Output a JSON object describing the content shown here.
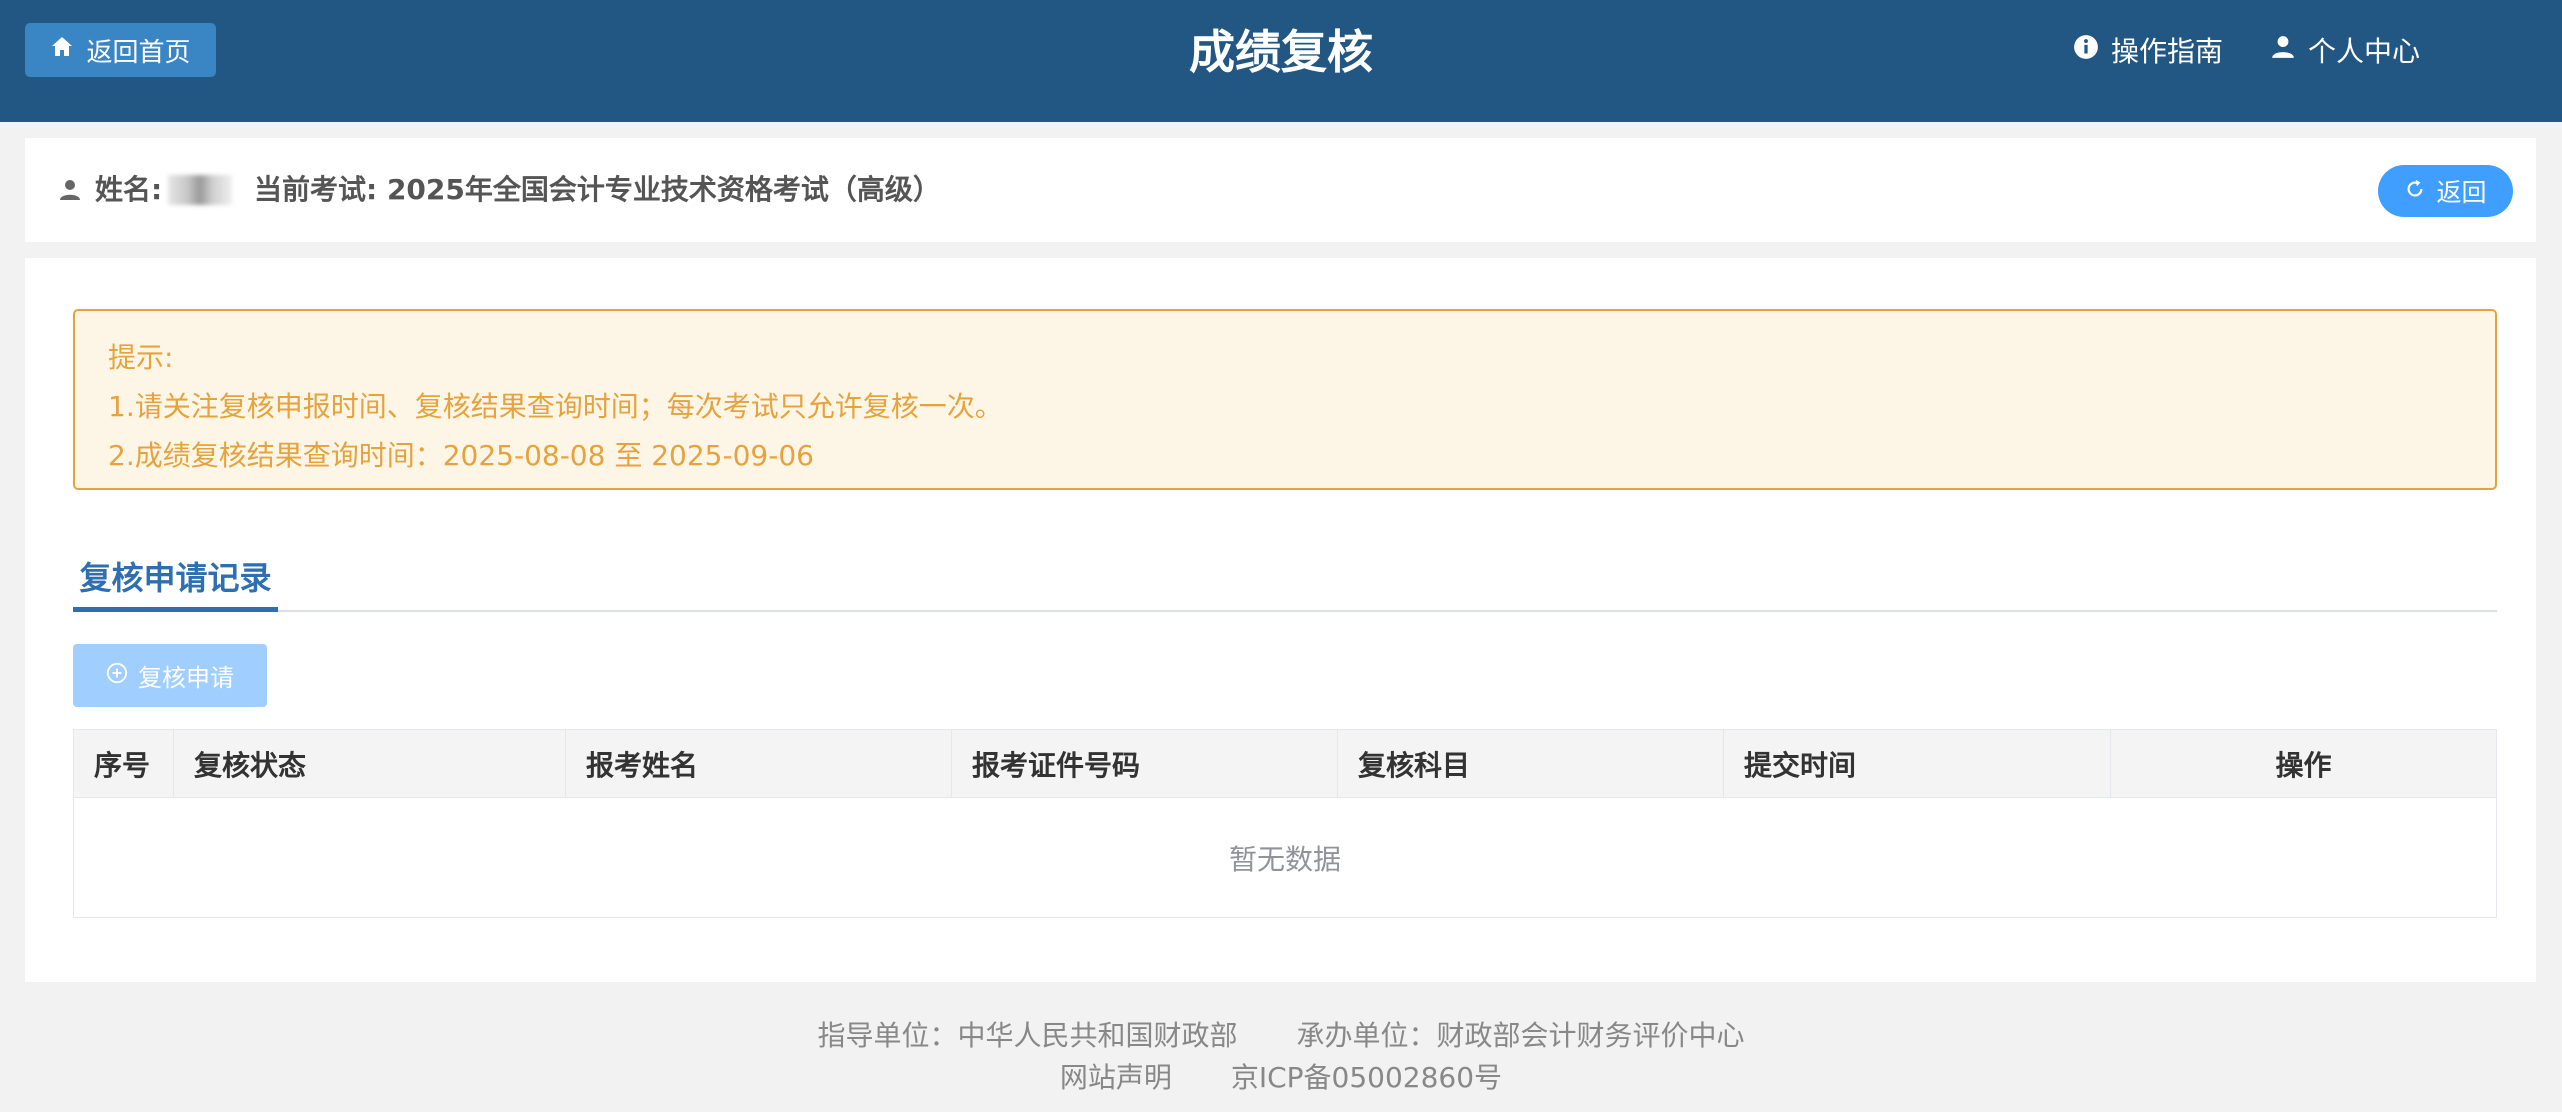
{
  "header": {
    "home_label": "返回首页",
    "title": "成绩复核",
    "guide_label": "操作指南",
    "user_center_label": "个人中心",
    "bg_color": "#225783"
  },
  "info_bar": {
    "name_label": "姓名:",
    "exam_label": "当前考试: 2025年全国会计专业技术资格考试（高级）",
    "back_label": "返回"
  },
  "notice": {
    "lines": [
      "提示:",
      "1.请关注复核申报时间、复核结果查询时间；每次考试只允许复核一次。",
      "2.成绩复核结果查询时间：2025-08-08 至 2025-09-06"
    ],
    "color": "#e6a23c"
  },
  "tabs": {
    "active_label": "复核申请记录"
  },
  "apply_button": {
    "label": "复核申请",
    "disabled": true
  },
  "table": {
    "columns": [
      "序号",
      "复核状态",
      "报考姓名",
      "报考证件号码",
      "复核科目",
      "提交时间",
      "操作"
    ],
    "rows": [],
    "empty_text": "暂无数据"
  },
  "footer": {
    "guide_unit": "指导单位：中华人民共和国财政部",
    "host_unit": "承办单位：财政部会计财务评价中心",
    "statement": "网站声明",
    "icp": "京ICP备05002860号"
  }
}
